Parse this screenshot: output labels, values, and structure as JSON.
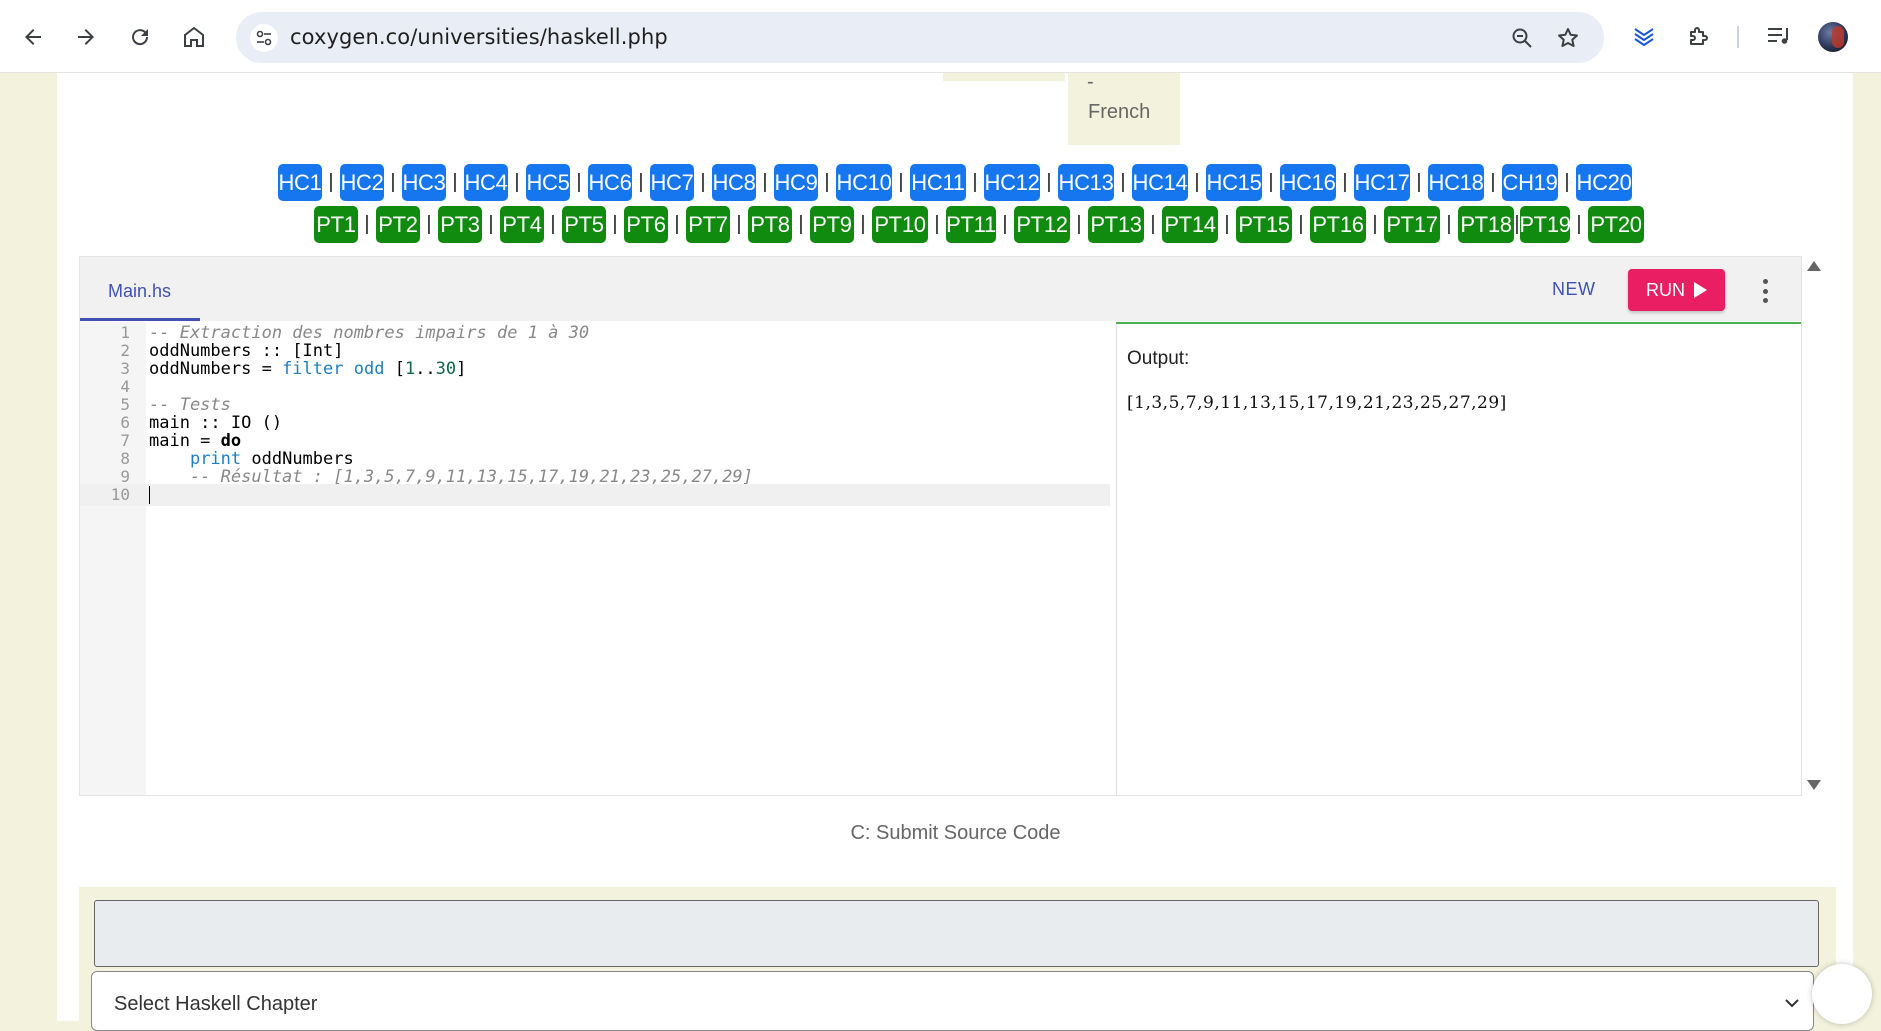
{
  "browser": {
    "url": "coxygen.co/universities/haskell.php",
    "icons": [
      "back-arrow-icon",
      "forward-arrow-icon",
      "reload-icon",
      "home-icon",
      "site-settings-icon",
      "zoom-icon",
      "bookmark-star-icon",
      "extension-layers-icon",
      "puzzle-extensions-icon",
      "media-queue-icon",
      "profile-avatar"
    ]
  },
  "language_tab": {
    "dash": "-",
    "label": "French"
  },
  "chapters": {
    "hc": [
      "HC1",
      "HC2",
      "HC3",
      "HC4",
      "HC5",
      "HC6",
      "HC7",
      "HC8",
      "HC9",
      "HC10",
      "HC11",
      "HC12",
      "HC13",
      "HC14",
      "HC15",
      "HC16",
      "HC17",
      "HC18",
      "CH19",
      "HC20"
    ],
    "pt": [
      "PT1",
      "PT2",
      "PT3",
      "PT4",
      "PT5",
      "PT6",
      "PT7",
      "PT8",
      "PT9",
      "PT10",
      "PT11",
      "PT12",
      "PT13",
      "PT14",
      "PT15",
      "PT16",
      "PT17",
      "PT18",
      "PT19",
      "PT20"
    ],
    "separator": "|",
    "colors": {
      "hc": "#1576ef",
      "pt": "#118a10"
    }
  },
  "ide": {
    "file_tab": "Main.hs",
    "new_label": "NEW",
    "run_label": "RUN",
    "run_color": "#e91e63",
    "line_numbers": [
      "1",
      "2",
      "3",
      "4",
      "5",
      "6",
      "7",
      "8",
      "9",
      "10"
    ],
    "code_lines": [
      "-- Extraction des nombres impairs de 1 à 30",
      "oddNumbers :: [Int]",
      "oddNumbers = filter odd [1..30]",
      "",
      "-- Tests",
      "main :: IO ()",
      "main = do",
      "    print oddNumbers",
      "    -- Résultat : [1,3,5,7,9,11,13,15,17,19,21,23,25,27,29]",
      ""
    ],
    "output_label": "Output:",
    "output_value": "[1,3,5,7,9,11,13,15,17,19,21,23,25,27,29]"
  },
  "submit": {
    "heading": "C: Submit Source Code",
    "select_placeholder": "Select Haskell Chapter"
  }
}
